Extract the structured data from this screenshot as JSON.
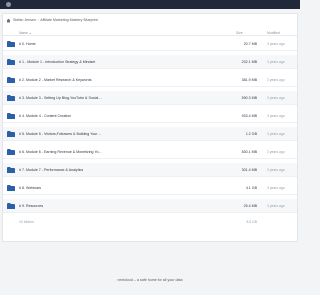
{
  "breadcrumb": {
    "items": [
      "Stefan Jensen",
      "Affiliate Marketing Mastery Blueprint"
    ]
  },
  "table": {
    "headers": {
      "name": "Name",
      "sort_indicator": "▲",
      "size": "Size",
      "modified": "Modified"
    },
    "rows": [
      {
        "name": "# 0. Home",
        "size": "20.7 MB",
        "modified": "3 years ago"
      },
      {
        "name": "# 1 - Module 1 - Introduction Strategy & Mindset",
        "size": "232.1 MB",
        "modified": "3 years ago"
      },
      {
        "name": "# 2. Module 2 - Market Research & Keywords",
        "size": "381.9 MB",
        "modified": "3 years ago"
      },
      {
        "name": "# 3. Module 3 - Setting Up Blog,YouTube & Social ...",
        "size": "590.3 MB",
        "modified": "3 years ago"
      },
      {
        "name": "# 4. Module 4 - Content Creation",
        "size": "933.4 MB",
        "modified": "3 years ago"
      },
      {
        "name": "# 5. Module 5 - Visitors,Followers & Building Your ...",
        "size": "1.2 GB",
        "modified": "3 years ago"
      },
      {
        "name": "# 6. Module 6 - Earning Revenue & Monetizing Yo...",
        "size": "830.1 MB",
        "modified": "3 years ago"
      },
      {
        "name": "# 7. Module 7 - Performance & Analytics",
        "size": "301.4 MB",
        "modified": "3 years ago"
      },
      {
        "name": "# 8. Webinars",
        "size": "4.1 GB",
        "modified": "3 years ago"
      },
      {
        "name": "# 9. Resources",
        "size": "25.4 MB",
        "modified": "3 years ago"
      }
    ],
    "summary": {
      "count": "10 folders",
      "total": "8.5 GB"
    }
  },
  "footer": {
    "text": "nextcloud – a safe home for all your data"
  },
  "colors": {
    "topbar": "#20283a",
    "folder": "#2b5fa8",
    "row_alt": "#f6f7f9"
  }
}
